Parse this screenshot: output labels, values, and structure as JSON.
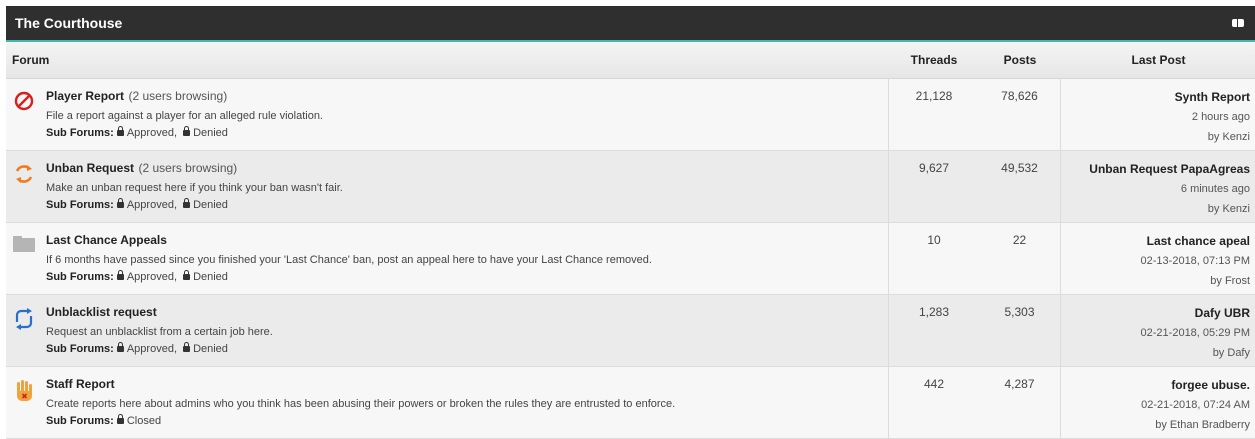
{
  "category": {
    "title": "The Courthouse"
  },
  "table_header": {
    "forum": "Forum",
    "threads": "Threads",
    "posts": "Posts",
    "last_post": "Last Post"
  },
  "sub_forums_label": "Sub Forums:",
  "forums": [
    {
      "icon": "prohibited-icon",
      "title": "Player Report",
      "browsing": "(2 users browsing)",
      "description": "File a report against a player for an alleged rule violation.",
      "sub_forums": [
        "Approved",
        "Denied"
      ],
      "threads": "21,128",
      "posts": "78,626",
      "last_post": {
        "title": "Synth Report",
        "time": "2 hours ago",
        "by": "by",
        "user": "Kenzi"
      }
    },
    {
      "icon": "refresh-orange-icon",
      "title": "Unban Request",
      "browsing": "(2 users browsing)",
      "description": "Make an unban request here if you think your ban wasn't fair.",
      "sub_forums": [
        "Approved",
        "Denied"
      ],
      "threads": "9,627",
      "posts": "49,532",
      "last_post": {
        "title": "Unban Request PapaAgreas",
        "time": "6 minutes ago",
        "by": "by",
        "user": "Kenzi"
      }
    },
    {
      "icon": "folder-icon",
      "title": "Last Chance Appeals",
      "browsing": "",
      "description": "If 6 months have passed since you finished your 'Last Chance' ban, post an appeal here to have your Last Chance removed.",
      "sub_forums": [
        "Approved",
        "Denied"
      ],
      "threads": "10",
      "posts": "22",
      "last_post": {
        "title": "Last chance apeal",
        "time": "02-13-2018, 07:13 PM",
        "by": "by",
        "user": "Frost"
      }
    },
    {
      "icon": "refresh-blue-icon",
      "title": "Unblacklist request",
      "browsing": "",
      "description": "Request an unblacklist from a certain job here.",
      "sub_forums": [
        "Approved",
        "Denied"
      ],
      "threads": "1,283",
      "posts": "5,303",
      "last_post": {
        "title": "Dafy UBR",
        "time": "02-21-2018, 05:29 PM",
        "by": "by",
        "user": "Dafy"
      }
    },
    {
      "icon": "raised-hand-icon",
      "title": "Staff Report",
      "browsing": "",
      "description": "Create reports here about admins who you think has been abusing their powers or broken the rules they are entrusted to enforce.",
      "sub_forums": [
        "Closed"
      ],
      "threads": "442",
      "posts": "4,287",
      "last_post": {
        "title": "forgee ubuse.",
        "time": "02-21-2018, 07:24 AM",
        "by": "by",
        "user": "Ethan Bradberry"
      }
    }
  ]
}
